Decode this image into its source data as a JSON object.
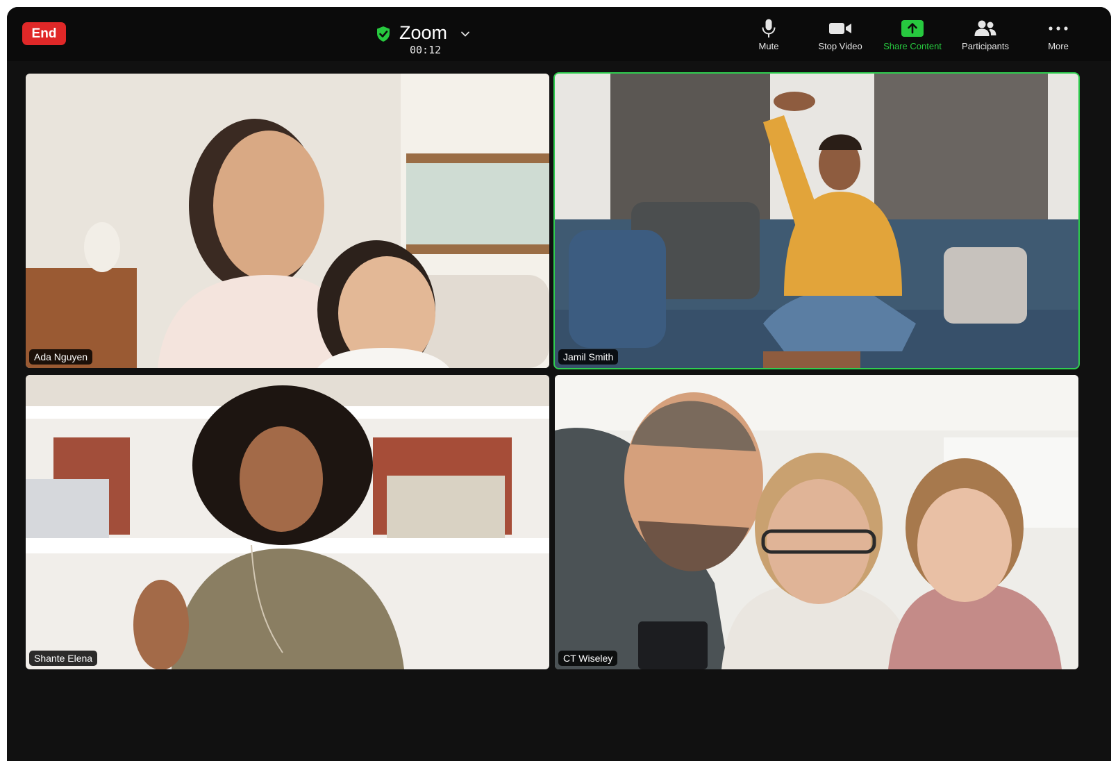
{
  "meeting": {
    "end_label": "End",
    "app_title": "Zoom",
    "timer": "00:12"
  },
  "toolbar": {
    "mute_label": "Mute",
    "stop_video_label": "Stop Video",
    "share_label": "Share Content",
    "participants_label": "Participants",
    "more_label": "More"
  },
  "tiles": [
    {
      "name": "Ada Nguyen",
      "active": false
    },
    {
      "name": "Jamil Smith",
      "active": true
    },
    {
      "name": "Shante Elena",
      "active": false
    },
    {
      "name": "CT Wiseley",
      "active": false
    }
  ],
  "colors": {
    "end_red": "#e02828",
    "share_green": "#27c93f",
    "active_border": "#2fcd4f",
    "bar_bg": "#0b0b0b"
  }
}
